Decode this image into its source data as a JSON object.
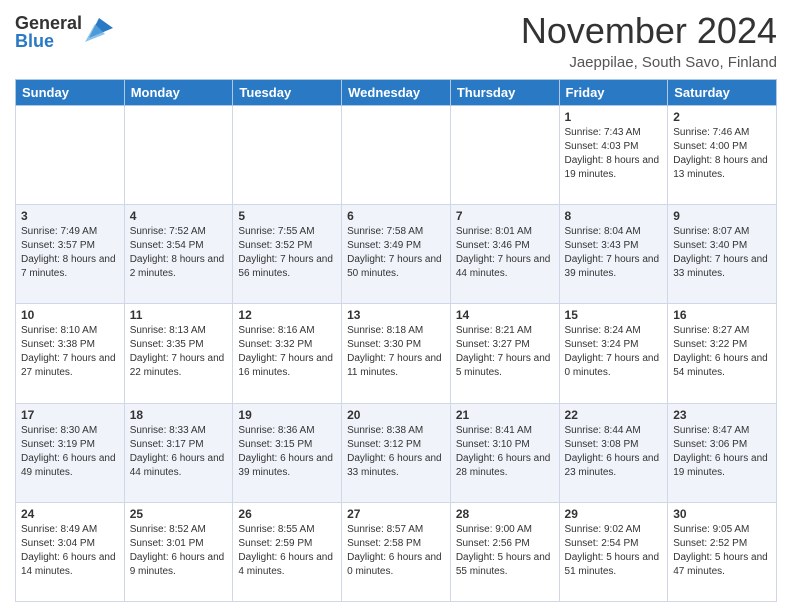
{
  "header": {
    "logo_general": "General",
    "logo_blue": "Blue",
    "month_title": "November 2024",
    "location": "Jaeppilae, South Savo, Finland"
  },
  "days_of_week": [
    "Sunday",
    "Monday",
    "Tuesday",
    "Wednesday",
    "Thursday",
    "Friday",
    "Saturday"
  ],
  "weeks": [
    [
      {
        "day": "",
        "info": ""
      },
      {
        "day": "",
        "info": ""
      },
      {
        "day": "",
        "info": ""
      },
      {
        "day": "",
        "info": ""
      },
      {
        "day": "",
        "info": ""
      },
      {
        "day": "1",
        "info": "Sunrise: 7:43 AM\nSunset: 4:03 PM\nDaylight: 8 hours and 19 minutes."
      },
      {
        "day": "2",
        "info": "Sunrise: 7:46 AM\nSunset: 4:00 PM\nDaylight: 8 hours and 13 minutes."
      }
    ],
    [
      {
        "day": "3",
        "info": "Sunrise: 7:49 AM\nSunset: 3:57 PM\nDaylight: 8 hours and 7 minutes."
      },
      {
        "day": "4",
        "info": "Sunrise: 7:52 AM\nSunset: 3:54 PM\nDaylight: 8 hours and 2 minutes."
      },
      {
        "day": "5",
        "info": "Sunrise: 7:55 AM\nSunset: 3:52 PM\nDaylight: 7 hours and 56 minutes."
      },
      {
        "day": "6",
        "info": "Sunrise: 7:58 AM\nSunset: 3:49 PM\nDaylight: 7 hours and 50 minutes."
      },
      {
        "day": "7",
        "info": "Sunrise: 8:01 AM\nSunset: 3:46 PM\nDaylight: 7 hours and 44 minutes."
      },
      {
        "day": "8",
        "info": "Sunrise: 8:04 AM\nSunset: 3:43 PM\nDaylight: 7 hours and 39 minutes."
      },
      {
        "day": "9",
        "info": "Sunrise: 8:07 AM\nSunset: 3:40 PM\nDaylight: 7 hours and 33 minutes."
      }
    ],
    [
      {
        "day": "10",
        "info": "Sunrise: 8:10 AM\nSunset: 3:38 PM\nDaylight: 7 hours and 27 minutes."
      },
      {
        "day": "11",
        "info": "Sunrise: 8:13 AM\nSunset: 3:35 PM\nDaylight: 7 hours and 22 minutes."
      },
      {
        "day": "12",
        "info": "Sunrise: 8:16 AM\nSunset: 3:32 PM\nDaylight: 7 hours and 16 minutes."
      },
      {
        "day": "13",
        "info": "Sunrise: 8:18 AM\nSunset: 3:30 PM\nDaylight: 7 hours and 11 minutes."
      },
      {
        "day": "14",
        "info": "Sunrise: 8:21 AM\nSunset: 3:27 PM\nDaylight: 7 hours and 5 minutes."
      },
      {
        "day": "15",
        "info": "Sunrise: 8:24 AM\nSunset: 3:24 PM\nDaylight: 7 hours and 0 minutes."
      },
      {
        "day": "16",
        "info": "Sunrise: 8:27 AM\nSunset: 3:22 PM\nDaylight: 6 hours and 54 minutes."
      }
    ],
    [
      {
        "day": "17",
        "info": "Sunrise: 8:30 AM\nSunset: 3:19 PM\nDaylight: 6 hours and 49 minutes."
      },
      {
        "day": "18",
        "info": "Sunrise: 8:33 AM\nSunset: 3:17 PM\nDaylight: 6 hours and 44 minutes."
      },
      {
        "day": "19",
        "info": "Sunrise: 8:36 AM\nSunset: 3:15 PM\nDaylight: 6 hours and 39 minutes."
      },
      {
        "day": "20",
        "info": "Sunrise: 8:38 AM\nSunset: 3:12 PM\nDaylight: 6 hours and 33 minutes."
      },
      {
        "day": "21",
        "info": "Sunrise: 8:41 AM\nSunset: 3:10 PM\nDaylight: 6 hours and 28 minutes."
      },
      {
        "day": "22",
        "info": "Sunrise: 8:44 AM\nSunset: 3:08 PM\nDaylight: 6 hours and 23 minutes."
      },
      {
        "day": "23",
        "info": "Sunrise: 8:47 AM\nSunset: 3:06 PM\nDaylight: 6 hours and 19 minutes."
      }
    ],
    [
      {
        "day": "24",
        "info": "Sunrise: 8:49 AM\nSunset: 3:04 PM\nDaylight: 6 hours and 14 minutes."
      },
      {
        "day": "25",
        "info": "Sunrise: 8:52 AM\nSunset: 3:01 PM\nDaylight: 6 hours and 9 minutes."
      },
      {
        "day": "26",
        "info": "Sunrise: 8:55 AM\nSunset: 2:59 PM\nDaylight: 6 hours and 4 minutes."
      },
      {
        "day": "27",
        "info": "Sunrise: 8:57 AM\nSunset: 2:58 PM\nDaylight: 6 hours and 0 minutes."
      },
      {
        "day": "28",
        "info": "Sunrise: 9:00 AM\nSunset: 2:56 PM\nDaylight: 5 hours and 55 minutes."
      },
      {
        "day": "29",
        "info": "Sunrise: 9:02 AM\nSunset: 2:54 PM\nDaylight: 5 hours and 51 minutes."
      },
      {
        "day": "30",
        "info": "Sunrise: 9:05 AM\nSunset: 2:52 PM\nDaylight: 5 hours and 47 minutes."
      }
    ]
  ]
}
